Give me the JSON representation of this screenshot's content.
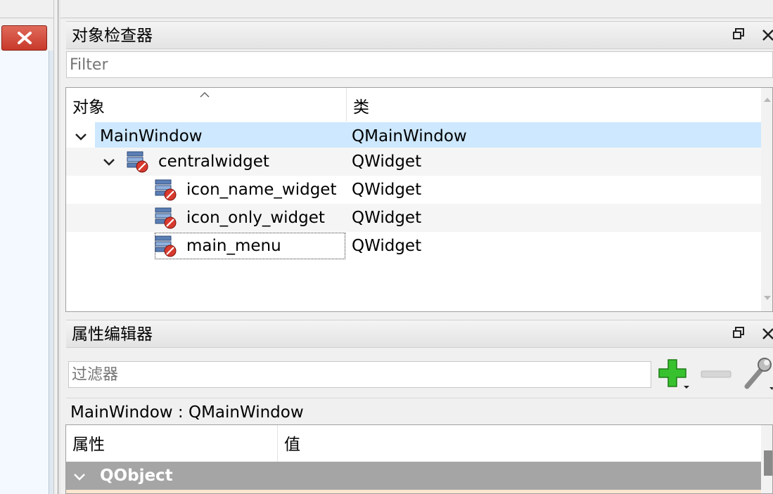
{
  "object_inspector": {
    "title": "对象检查器",
    "filter_placeholder": "Filter",
    "columns": {
      "object": "对象",
      "class": "类"
    },
    "rows": [
      {
        "name": "MainWindow",
        "class": "QMainWindow"
      },
      {
        "name": "centralwidget",
        "class": "QWidget"
      },
      {
        "name": "icon_name_widget",
        "class": "QWidget"
      },
      {
        "name": "icon_only_widget",
        "class": "QWidget"
      },
      {
        "name": "main_menu",
        "class": "QWidget"
      }
    ]
  },
  "property_editor": {
    "title": "属性编辑器",
    "filter_placeholder": "过滤器",
    "current_object": "MainWindow : QMainWindow",
    "columns": {
      "property": "属性",
      "value": "值"
    },
    "group": "QObject"
  },
  "icons": {
    "dock_float": "float-icon",
    "dock_close": "close-icon",
    "widget": "widget-layout-broken-icon",
    "add": "plus-icon",
    "remove": "minus-icon",
    "configure": "wrench-icon"
  },
  "colors": {
    "selected_row": "#cde8ff",
    "alt_row": "#f5f5f5",
    "group_row": "#a5a5a5",
    "add_green": "#2fb526",
    "close_red": "#c8392b"
  }
}
